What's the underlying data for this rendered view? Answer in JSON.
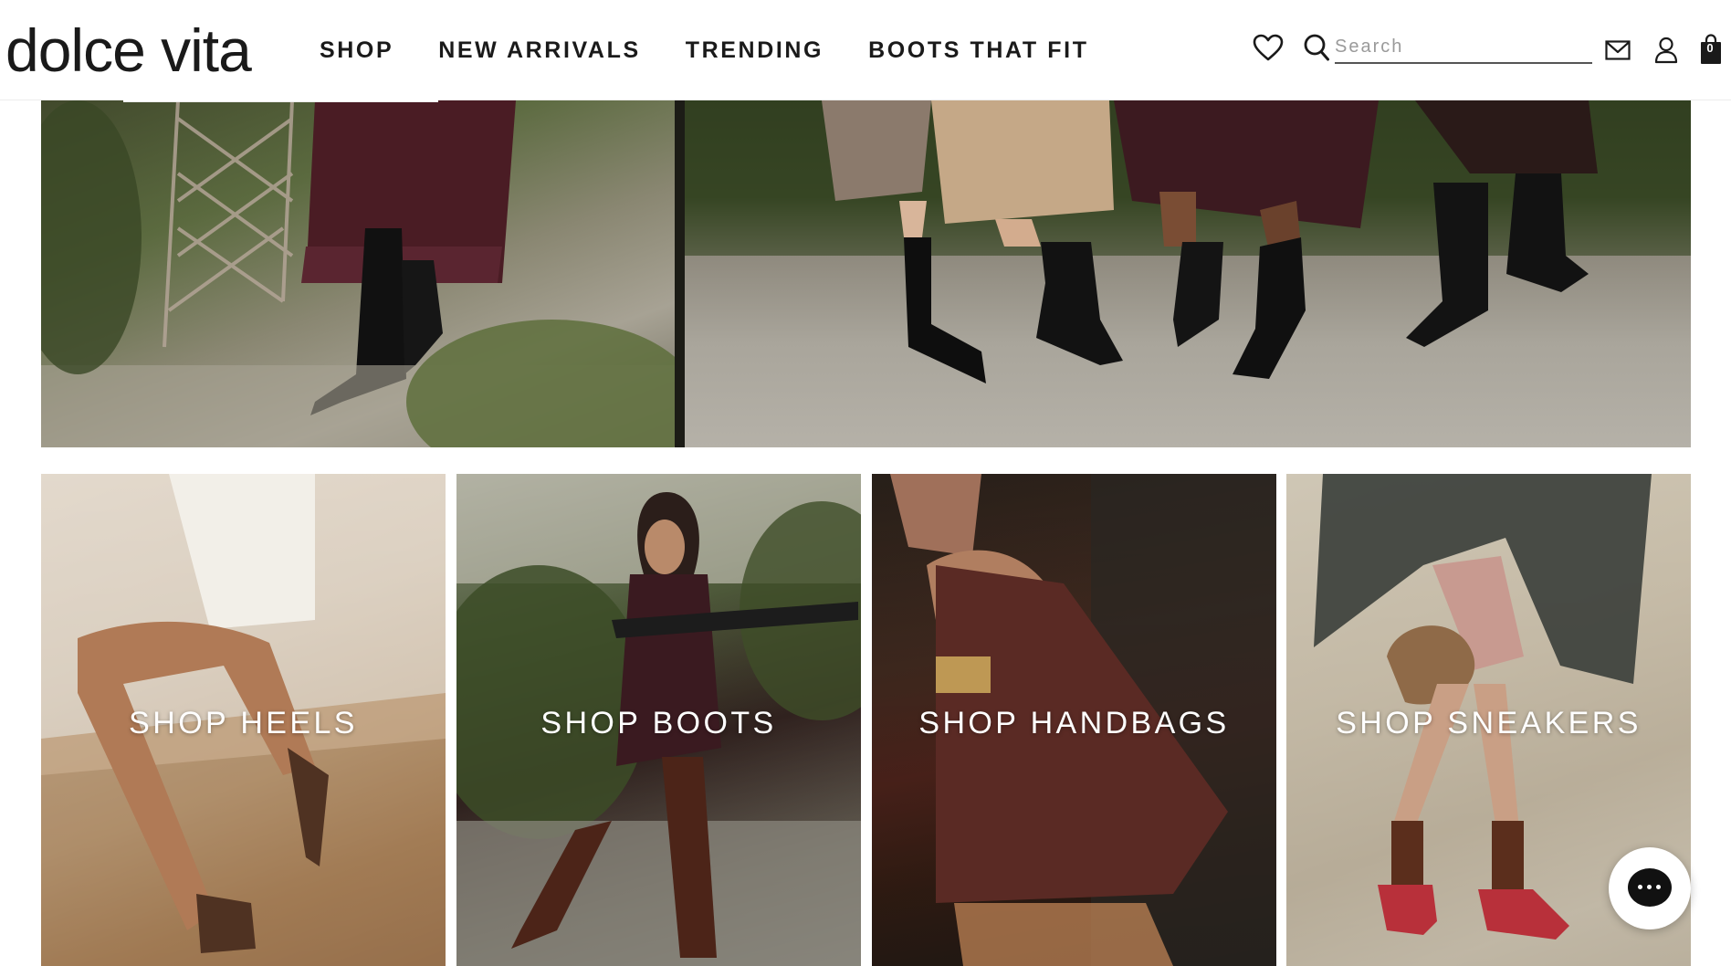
{
  "brand": {
    "logo_text": "dolce vita"
  },
  "nav": {
    "items": [
      {
        "label": "SHOP"
      },
      {
        "label": "NEW ARRIVALS"
      },
      {
        "label": "TRENDING"
      },
      {
        "label": "BOOTS THAT FIT"
      }
    ]
  },
  "header_icons": {
    "wishlist": "heart-icon",
    "search": "search-icon",
    "newsletter": "mail-icon",
    "account": "user-icon",
    "cart": "bag-icon"
  },
  "search": {
    "placeholder": "Search",
    "value": ""
  },
  "cart": {
    "count": "0"
  },
  "hero": {
    "left_image": "woman-in-burgundy-dress-black-boots-garden-photo",
    "right_image": "group-wearing-black-knee-high-boots-photo"
  },
  "categories": [
    {
      "label": "SHOP HEELS"
    },
    {
      "label": "SHOP BOOTS"
    },
    {
      "label": "SHOP HANDBAGS"
    },
    {
      "label": "SHOP SNEAKERS"
    }
  ],
  "chat": {
    "icon": "chat-bubble-icon"
  },
  "colors": {
    "text": "#1a1a1a",
    "header_bg": "#ffffff",
    "tile_label": "#ffffff",
    "chat_bg": "#111111"
  }
}
